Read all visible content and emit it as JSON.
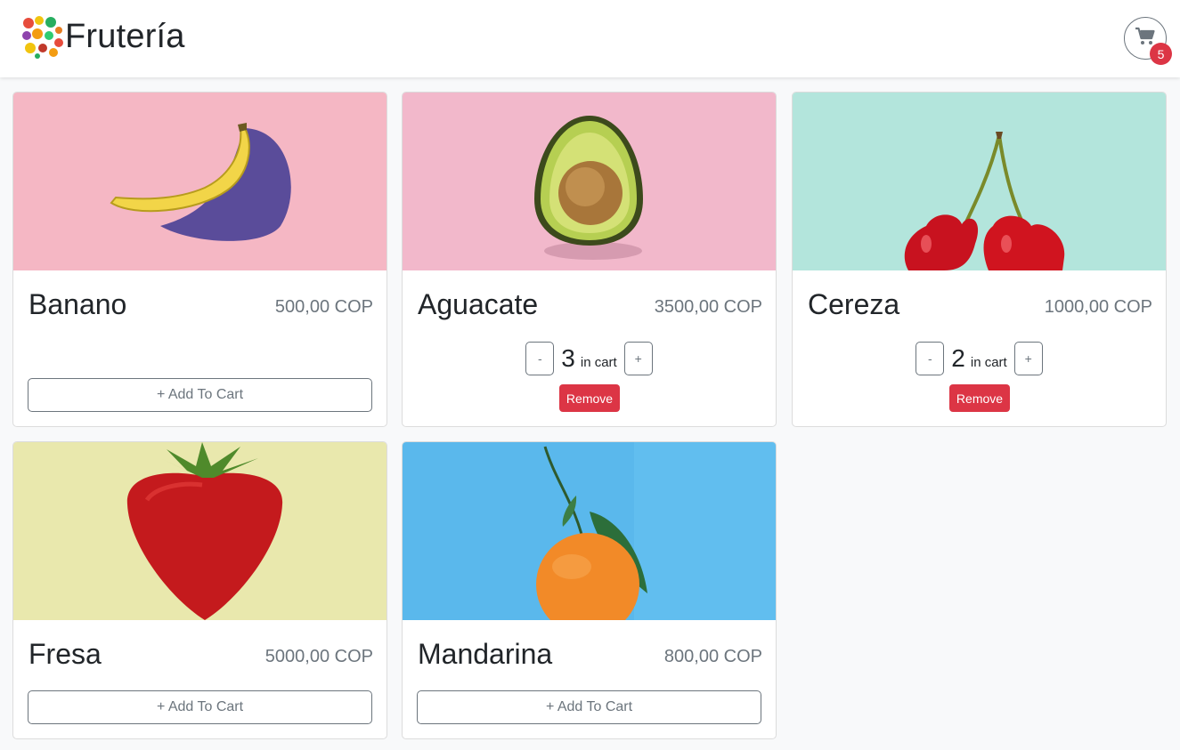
{
  "navbar": {
    "brand_name": "Frutería",
    "cart_count": "5"
  },
  "colors": {
    "danger": "#dc3545",
    "secondary": "#6c757d",
    "background": "#f8f9fa"
  },
  "products": [
    {
      "name": "Banano",
      "price": "500,00 COP",
      "button_label": "+ Add To Cart",
      "image_bg": "#f5b7c4"
    },
    {
      "name": "Aguacate",
      "price": "3500,00 COP",
      "quantity": "3",
      "in_cart_label": "in cart",
      "minus_label": "-",
      "plus_label": "+",
      "remove_label": "Remove",
      "image_bg": "#f2b8cb"
    },
    {
      "name": "Cereza",
      "price": "1000,00 COP",
      "quantity": "2",
      "in_cart_label": "in cart",
      "minus_label": "-",
      "plus_label": "+",
      "remove_label": "Remove",
      "image_bg": "#b3e5dc"
    },
    {
      "name": "Fresa",
      "price": "5000,00 COP",
      "button_label": "+ Add To Cart",
      "image_bg": "#e9e8ad"
    },
    {
      "name": "Mandarina",
      "price": "800,00 COP",
      "button_label": "+ Add To Cart",
      "image_bg": "#5ab8ec"
    }
  ]
}
